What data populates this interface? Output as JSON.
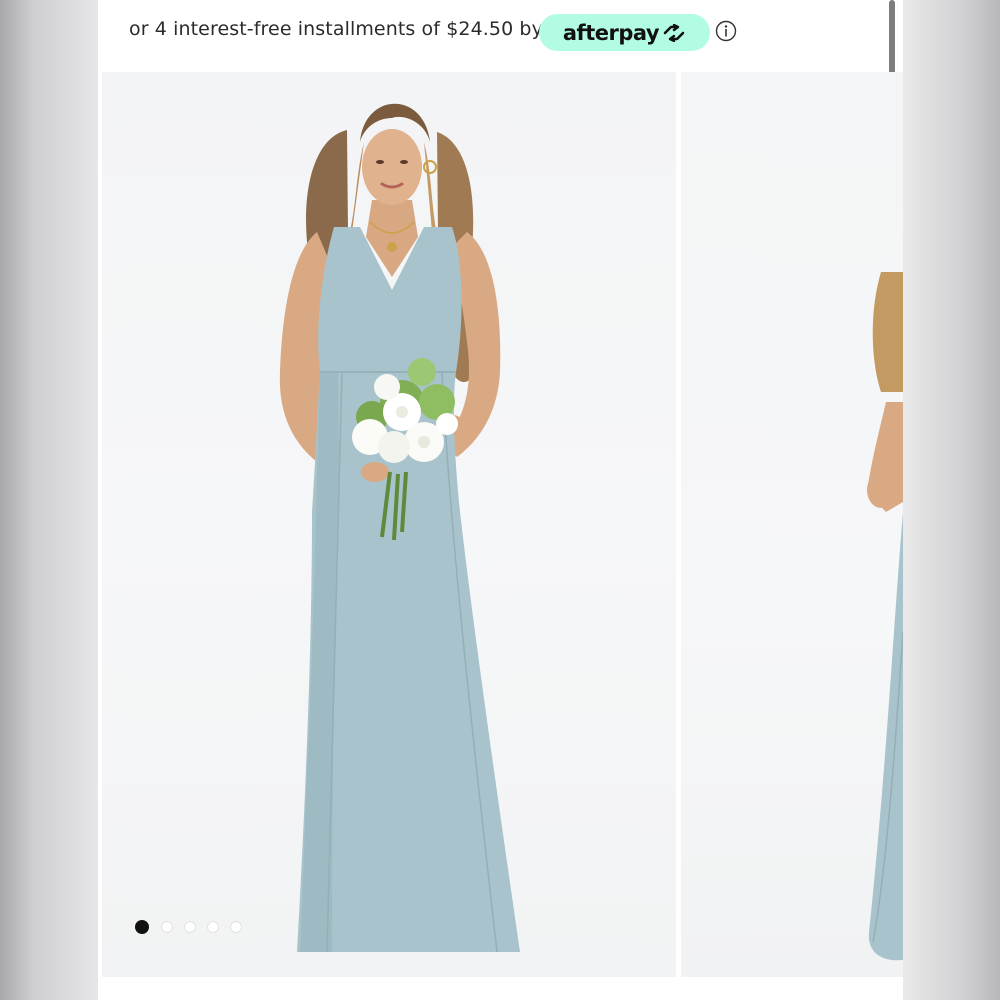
{
  "afterpay": {
    "text": "or 4 interest-free installments of $24.50 by",
    "brand": "afterpay",
    "badge_color": "#b2fce4"
  },
  "icons": {
    "info": "info-icon",
    "afterpay_arrows": "afterpay-arrows-icon"
  },
  "gallery": {
    "slide_count": 5,
    "active_slide": 1,
    "dress_color": "#a9c4cc",
    "dots": [
      "1",
      "2",
      "3",
      "4",
      "5"
    ]
  }
}
